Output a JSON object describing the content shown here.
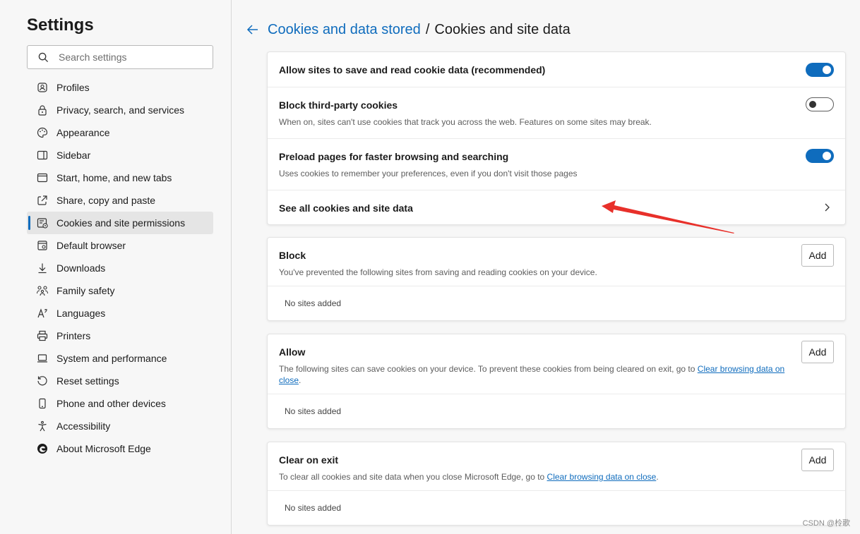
{
  "sidebar": {
    "title": "Settings",
    "search_placeholder": "Search settings",
    "items": [
      {
        "label": "Profiles",
        "icon": "profile-icon"
      },
      {
        "label": "Privacy, search, and services",
        "icon": "lock-icon"
      },
      {
        "label": "Appearance",
        "icon": "palette-icon"
      },
      {
        "label": "Sidebar",
        "icon": "sidebar-icon"
      },
      {
        "label": "Start, home, and new tabs",
        "icon": "home-tabs-icon"
      },
      {
        "label": "Share, copy and paste",
        "icon": "share-icon"
      },
      {
        "label": "Cookies and site permissions",
        "icon": "cookies-permissions-icon",
        "active": true
      },
      {
        "label": "Default browser",
        "icon": "browser-icon"
      },
      {
        "label": "Downloads",
        "icon": "download-icon"
      },
      {
        "label": "Family safety",
        "icon": "family-icon"
      },
      {
        "label": "Languages",
        "icon": "language-icon"
      },
      {
        "label": "Printers",
        "icon": "printer-icon"
      },
      {
        "label": "System and performance",
        "icon": "laptop-icon"
      },
      {
        "label": "Reset settings",
        "icon": "reset-icon"
      },
      {
        "label": "Phone and other devices",
        "icon": "phone-icon"
      },
      {
        "label": "Accessibility",
        "icon": "accessibility-icon"
      },
      {
        "label": "About Microsoft Edge",
        "icon": "edge-logo-icon"
      }
    ]
  },
  "header": {
    "breadcrumb_parent": "Cookies and data stored",
    "separator": "/",
    "breadcrumb_current": "Cookies and site data"
  },
  "settings": {
    "allow_cookies": {
      "title": "Allow sites to save and read cookie data (recommended)",
      "enabled": true
    },
    "block_third_party": {
      "title": "Block third-party cookies",
      "description": "When on, sites can't use cookies that track you across the web. Features on some sites may break.",
      "enabled": false
    },
    "preload": {
      "title": "Preload pages for faster browsing and searching",
      "description": "Uses cookies to remember your preferences, even if you don't visit those pages",
      "enabled": true
    },
    "see_all": {
      "title": "See all cookies and site data"
    }
  },
  "block": {
    "title": "Block",
    "description": "You've prevented the following sites from saving and reading cookies on your device.",
    "add_label": "Add",
    "empty": "No sites added"
  },
  "allow": {
    "title": "Allow",
    "description_prefix": "The following sites can save cookies on your device. To prevent these cookies from being cleared on exit, go to ",
    "link": "Clear browsing data on close",
    "description_suffix": ".",
    "add_label": "Add",
    "empty": "No sites added"
  },
  "clear_on_exit": {
    "title": "Clear on exit",
    "description_prefix": "To clear all cookies and site data when you close Microsoft Edge, go to ",
    "link": "Clear browsing data on close",
    "description_suffix": ".",
    "add_label": "Add",
    "empty": "No sites added"
  },
  "watermark": "CSDN @柃歌",
  "colors": {
    "accent": "#0f6cbd",
    "annotation_arrow": "#e8302a"
  }
}
